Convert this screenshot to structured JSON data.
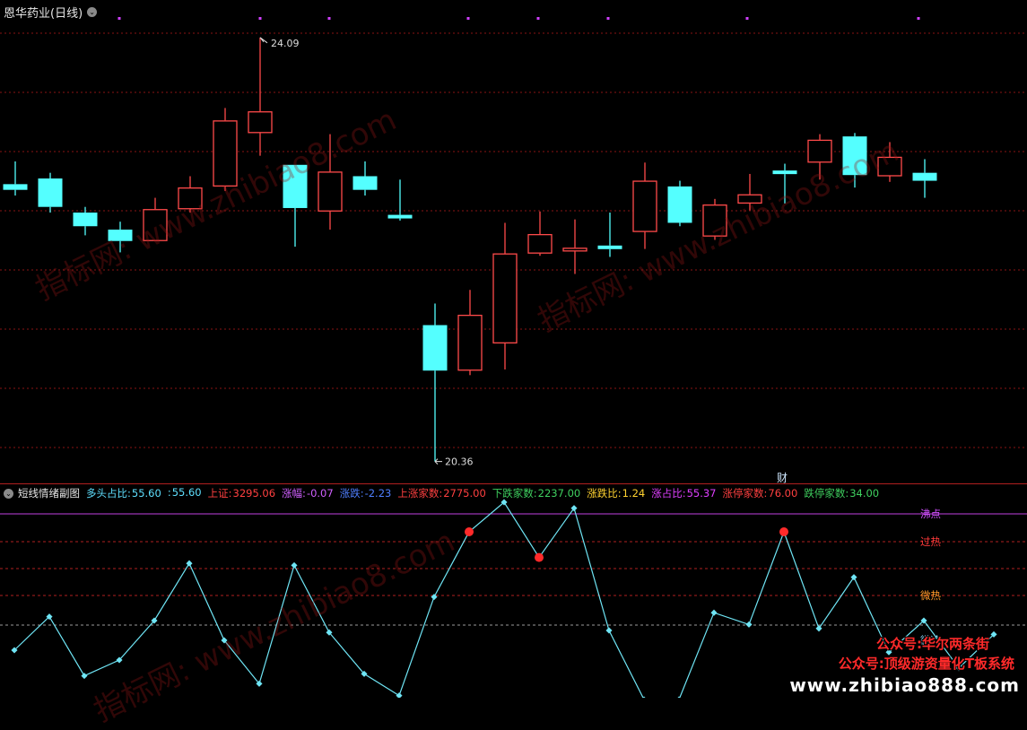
{
  "main": {
    "title": "恩华药业(日线)",
    "high_label": "24.09",
    "low_label": "20.36",
    "cai_label": "财",
    "candles": [
      {
        "o": 22.8,
        "h": 23.0,
        "l": 22.7,
        "c": 22.75
      },
      {
        "o": 22.85,
        "h": 22.9,
        "l": 22.55,
        "c": 22.6
      },
      {
        "o": 22.55,
        "h": 22.6,
        "l": 22.35,
        "c": 22.43
      },
      {
        "o": 22.4,
        "h": 22.47,
        "l": 22.2,
        "c": 22.3
      },
      {
        "o": 22.3,
        "h": 22.68,
        "l": 22.3,
        "c": 22.58
      },
      {
        "o": 22.58,
        "h": 22.87,
        "l": 22.55,
        "c": 22.77
      },
      {
        "o": 22.78,
        "h": 23.47,
        "l": 22.74,
        "c": 23.36
      },
      {
        "o": 23.25,
        "h": 24.09,
        "l": 23.05,
        "c": 23.44
      },
      {
        "o": 22.97,
        "h": 22.97,
        "l": 22.25,
        "c": 22.59
      },
      {
        "o": 22.56,
        "h": 23.24,
        "l": 22.4,
        "c": 22.91
      },
      {
        "o": 22.87,
        "h": 23.0,
        "l": 22.7,
        "c": 22.75
      },
      {
        "o": 22.53,
        "h": 22.84,
        "l": 22.48,
        "c": 22.51
      },
      {
        "o": 21.56,
        "h": 21.75,
        "l": 20.36,
        "c": 21.16
      },
      {
        "o": 21.16,
        "h": 21.87,
        "l": 21.12,
        "c": 21.65
      },
      {
        "o": 21.4,
        "h": 22.46,
        "l": 21.17,
        "c": 22.19
      },
      {
        "o": 22.19,
        "h": 22.56,
        "l": 22.17,
        "c": 22.36
      },
      {
        "o": 22.21,
        "h": 22.49,
        "l": 22.01,
        "c": 22.24
      },
      {
        "o": 22.26,
        "h": 22.55,
        "l": 22.16,
        "c": 22.24
      },
      {
        "o": 22.38,
        "h": 22.99,
        "l": 22.23,
        "c": 22.83
      },
      {
        "o": 22.78,
        "h": 22.83,
        "l": 22.43,
        "c": 22.46
      },
      {
        "o": 22.34,
        "h": 22.67,
        "l": 22.31,
        "c": 22.62
      },
      {
        "o": 22.63,
        "h": 22.89,
        "l": 22.57,
        "c": 22.71
      },
      {
        "o": 22.92,
        "h": 22.98,
        "l": 22.63,
        "c": 22.9
      },
      {
        "o": 22.99,
        "h": 23.24,
        "l": 22.84,
        "c": 23.19
      },
      {
        "o": 23.22,
        "h": 23.25,
        "l": 22.77,
        "c": 22.88
      },
      {
        "o": 22.87,
        "h": 23.17,
        "l": 22.82,
        "c": 23.04
      },
      {
        "o": 22.9,
        "h": 23.02,
        "l": 22.68,
        "c": 22.83
      }
    ]
  },
  "sub": {
    "title": "短线情绪副图",
    "stats": [
      {
        "label": "多头占比:",
        "value": "55.60",
        "color": "#5fe0ff"
      },
      {
        "label": ":",
        "value": "55.60",
        "color": "#5fe0ff"
      },
      {
        "label": "上证:",
        "value": "3295.06",
        "color": "#ff4040"
      },
      {
        "label": "涨幅:",
        "value": "-0.07",
        "color": "#d060ff"
      },
      {
        "label": "涨跌:",
        "value": "-2.23",
        "color": "#4f7fff"
      },
      {
        "label": "上涨家数:",
        "value": "2775.00",
        "color": "#ff4040"
      },
      {
        "label": "下跌家数:",
        "value": "2237.00",
        "color": "#3fd05f"
      },
      {
        "label": "涨跌比:",
        "value": "1.24",
        "color": "#ffd230"
      },
      {
        "label": "涨占比:",
        "value": "55.37",
        "color": "#e040ff"
      },
      {
        "label": "涨停家数:",
        "value": "76.00",
        "color": "#ff4040"
      },
      {
        "label": "跌停家数:",
        "value": "34.00",
        "color": "#3fd05f"
      }
    ],
    "levels": [
      {
        "label": "沸点",
        "color": "#d050ff"
      },
      {
        "label": "过热",
        "color": "#ff3a3a"
      },
      {
        "label": "微热",
        "color": "#ff9a2a"
      },
      {
        "label": "微冷",
        "color": "#8fdfff"
      }
    ],
    "line": [
      25,
      42,
      12,
      20,
      40,
      69,
      30,
      8,
      68,
      34,
      13,
      2,
      52,
      85,
      100,
      72,
      97,
      35,
      0,
      0,
      44,
      38,
      85,
      36,
      62,
      24,
      40,
      16,
      33
    ],
    "hot_points": [
      13,
      15,
      22
    ]
  },
  "watermarks": [
    "指标网: www.zhibiao8.com",
    "指标网: www.zhibiao8.com",
    "指标网: www.zhibiao8.com"
  ],
  "promo": {
    "line1": "公众号:华尔两条街",
    "line2": "公众号:顶级游资量化T板系统",
    "url": "www.zhibiao888.com"
  },
  "colors": {
    "up": "#ff4a4a",
    "down": "#54ffff",
    "grid": "#8a1515",
    "line": "#6fe5f5",
    "hot": "#ff2a2a"
  }
}
